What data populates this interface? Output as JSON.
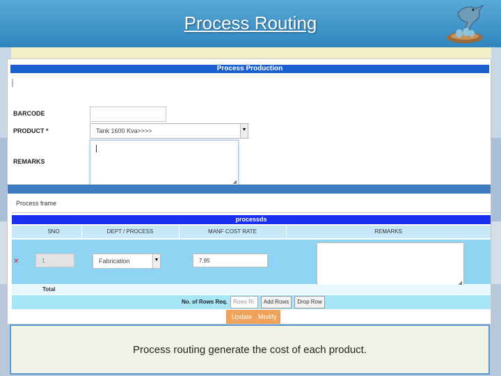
{
  "slide": {
    "title": "Process Routing",
    "caption": "Process routing generate the cost of each product."
  },
  "form": {
    "header": "Process Production",
    "barcode_label": "BARCODE",
    "barcode_value": "",
    "product_label": "PRODUCT *",
    "product_value": "Tank 1600 Kva>>>>",
    "remarks_label": "REMARKS",
    "process_frame_label": "Process frame"
  },
  "grid": {
    "title": "processds",
    "columns": [
      "SNO",
      "DEPT / PROCESS",
      "MANF COST RATE",
      "REMARKS"
    ],
    "rows": [
      {
        "sno": "1",
        "dept": "Fabrication",
        "cost": "7.95",
        "remarks": ""
      }
    ],
    "total_label": "Total",
    "rows_req_label": "No. of Rows Req.",
    "rows_req_placeholder": "Rows Ri",
    "add_rows_label": "Add Rows",
    "drop_row_label": "Drop Row"
  },
  "actions": {
    "update_label": "Update",
    "modify_label": "Modify"
  },
  "colors": {
    "header_blue": "#1a5fd0",
    "grid_blue": "#1a2ff0",
    "row_bg": "#8fd4f2",
    "action_orange": "#f0a25b"
  }
}
